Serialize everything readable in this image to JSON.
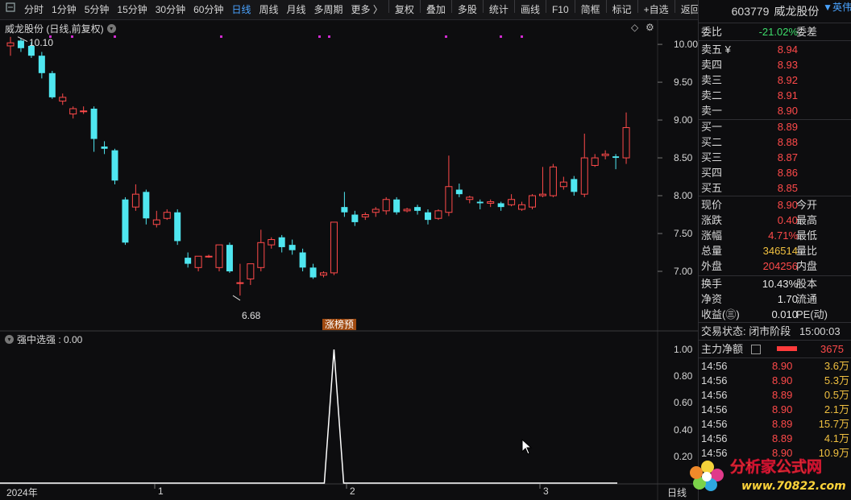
{
  "toolbar": {
    "items": [
      "分时",
      "1分钟",
      "5分钟",
      "15分钟",
      "30分钟",
      "60分钟",
      "日线",
      "周线",
      "月线",
      "多周期",
      "更多 〉"
    ],
    "active": "日线",
    "right_items": [
      "复权",
      "叠加",
      "多股",
      "统计",
      "画线",
      "F10",
      "简框",
      "标记",
      "+自选",
      "返回"
    ]
  },
  "chart": {
    "title": "威龙股份 (日线,前复权)",
    "high_label": "10.10",
    "low_label": "6.68",
    "tag_label": "涨榜预",
    "indicator_title": "强中选强 : 0.00",
    "date_labels": [
      "2024年",
      "1",
      "2",
      "3"
    ],
    "period_label": "日线",
    "price_axis": [
      "10.00",
      "9.50",
      "9.00",
      "8.50",
      "8.00",
      "7.50",
      "7.00"
    ],
    "ind_axis": [
      "1.00",
      "0.80",
      "0.60",
      "0.40",
      "0.20"
    ]
  },
  "chart_data": {
    "type": "candlestick",
    "ylim": [
      6.5,
      10.15
    ],
    "candles": [
      [
        9.98,
        10.1,
        9.85,
        10.02
      ],
      [
        10.05,
        10.08,
        9.9,
        9.95
      ],
      [
        9.98,
        10.03,
        9.82,
        9.85
      ],
      [
        9.85,
        9.9,
        9.55,
        9.62
      ],
      [
        9.62,
        9.65,
        9.28,
        9.3
      ],
      [
        9.25,
        9.35,
        9.2,
        9.3
      ],
      [
        9.08,
        9.18,
        9.02,
        9.15
      ],
      [
        9.12,
        9.18,
        9.08,
        9.12
      ],
      [
        9.15,
        9.18,
        8.58,
        8.75
      ],
      [
        8.65,
        8.72,
        8.55,
        8.62
      ],
      [
        8.6,
        8.62,
        8.15,
        8.2
      ],
      [
        7.95,
        7.98,
        7.35,
        7.38
      ],
      [
        7.85,
        8.15,
        7.8,
        8.02
      ],
      [
        8.05,
        8.08,
        7.62,
        7.7
      ],
      [
        7.62,
        7.8,
        7.58,
        7.68
      ],
      [
        7.7,
        7.82,
        7.68,
        7.78
      ],
      [
        7.78,
        7.82,
        7.35,
        7.4
      ],
      [
        7.18,
        7.25,
        7.05,
        7.1
      ],
      [
        7.05,
        7.2,
        7.0,
        7.2
      ],
      [
        7.2,
        7.22,
        7.18,
        7.2
      ],
      [
        7.05,
        7.3,
        7.0,
        7.35
      ],
      [
        7.35,
        7.38,
        6.98,
        7.0
      ],
      [
        6.85,
        7.1,
        6.68,
        6.85
      ],
      [
        6.9,
        7.05,
        6.82,
        7.1
      ],
      [
        7.05,
        7.55,
        7.0,
        7.38
      ],
      [
        7.35,
        7.45,
        7.3,
        7.42
      ],
      [
        7.45,
        7.48,
        7.25,
        7.32
      ],
      [
        7.35,
        7.42,
        7.22,
        7.28
      ],
      [
        7.25,
        7.3,
        7.0,
        7.05
      ],
      [
        7.05,
        7.1,
        6.9,
        6.92
      ],
      [
        6.95,
        7.0,
        6.92,
        6.98
      ],
      [
        6.98,
        7.05,
        6.95,
        7.65
      ],
      [
        7.85,
        8.05,
        7.72,
        7.78
      ],
      [
        7.75,
        7.8,
        7.6,
        7.65
      ],
      [
        7.72,
        7.78,
        7.68,
        7.75
      ],
      [
        7.78,
        7.85,
        7.72,
        7.82
      ],
      [
        7.8,
        7.98,
        7.75,
        7.95
      ],
      [
        7.95,
        7.98,
        7.75,
        7.78
      ],
      [
        7.8,
        7.84,
        7.78,
        7.82
      ],
      [
        7.85,
        7.88,
        7.75,
        7.8
      ],
      [
        7.78,
        7.82,
        7.62,
        7.68
      ],
      [
        7.7,
        7.82,
        7.68,
        7.8
      ],
      [
        7.78,
        8.53,
        7.73,
        8.12
      ],
      [
        8.08,
        8.16,
        7.98,
        8.02
      ],
      [
        7.95,
        8.0,
        7.9,
        7.98
      ],
      [
        7.92,
        7.95,
        7.82,
        7.9
      ],
      [
        7.9,
        7.95,
        7.85,
        7.92
      ],
      [
        7.9,
        7.92,
        7.8,
        7.85
      ],
      [
        7.88,
        8.02,
        7.86,
        7.95
      ],
      [
        7.82,
        7.92,
        7.8,
        7.88
      ],
      [
        7.85,
        8.02,
        7.82,
        8.0
      ],
      [
        8.0,
        8.38,
        7.98,
        8.02
      ],
      [
        8.0,
        8.42,
        7.98,
        8.38
      ],
      [
        8.12,
        8.25,
        8.08,
        8.18
      ],
      [
        8.22,
        8.26,
        8.0,
        8.05
      ],
      [
        8.02,
        8.82,
        7.98,
        8.5
      ],
      [
        8.4,
        8.55,
        8.38,
        8.5
      ],
      [
        8.53,
        8.6,
        8.48,
        8.55
      ],
      [
        8.52,
        8.55,
        8.35,
        8.5
      ],
      [
        8.5,
        9.1,
        8.42,
        8.9
      ]
    ],
    "indicator": {
      "name": "强中选强",
      "value": 0.0,
      "ylim": [
        0,
        1.0
      ],
      "spike_index": 31,
      "spike_value": 1.0
    }
  },
  "right_panel": {
    "code": "603779",
    "name": "威龙股份",
    "flag": "▼英伟",
    "weibi_label": "委比",
    "weibi_value": "-21.02%",
    "weicha_label": "委差",
    "asks": [
      {
        "label": "卖五 ¥",
        "price": "8.94"
      },
      {
        "label": "卖四",
        "price": "8.93"
      },
      {
        "label": "卖三",
        "price": "8.92"
      },
      {
        "label": "卖二",
        "price": "8.91"
      },
      {
        "label": "卖一",
        "price": "8.90"
      }
    ],
    "bids": [
      {
        "label": "买一",
        "price": "8.89"
      },
      {
        "label": "买二",
        "price": "8.88"
      },
      {
        "label": "买三",
        "price": "8.87"
      },
      {
        "label": "买四",
        "price": "8.86"
      },
      {
        "label": "买五",
        "price": "8.85"
      }
    ],
    "stats": [
      {
        "k": "现价",
        "v": "8.90",
        "k2": "今开",
        "cls": "red"
      },
      {
        "k": "涨跌",
        "v": "0.40",
        "k2": "最高",
        "cls": "red"
      },
      {
        "k": "涨幅",
        "v": "4.71%",
        "k2": "最低",
        "cls": "red"
      },
      {
        "k": "总量",
        "v": "346514",
        "k2": "量比",
        "cls": "yellow"
      },
      {
        "k": "外盘",
        "v": "204256",
        "k2": "内盘",
        "cls": "red"
      }
    ],
    "stats2": [
      {
        "k": "换手",
        "v": "10.43%",
        "k2": "股本"
      },
      {
        "k": "净资",
        "v": "1.70",
        "k2": "流通"
      },
      {
        "k": "收益(㊂)",
        "v": "0.010",
        "k2": "PE(动)"
      }
    ],
    "trade_status_label": "交易状态: 闭市阶段",
    "trade_status_time": "15:00:03",
    "main_flow_label": "主力净额",
    "main_flow_value": "3675",
    "ticks": [
      {
        "t": "14:56",
        "p": "8.90",
        "v": "3.6万"
      },
      {
        "t": "14:56",
        "p": "8.90",
        "v": "5.3万"
      },
      {
        "t": "14:56",
        "p": "8.89",
        "v": "0.5万"
      },
      {
        "t": "14:56",
        "p": "8.90",
        "v": "2.1万"
      },
      {
        "t": "14:56",
        "p": "8.89",
        "v": "15.7万"
      },
      {
        "t": "14:56",
        "p": "8.89",
        "v": "4.1万"
      },
      {
        "t": "14:56",
        "p": "8.90",
        "v": "10.9万"
      }
    ]
  },
  "watermark": {
    "text": "分析家公式网",
    "url": "www.70822.com"
  }
}
